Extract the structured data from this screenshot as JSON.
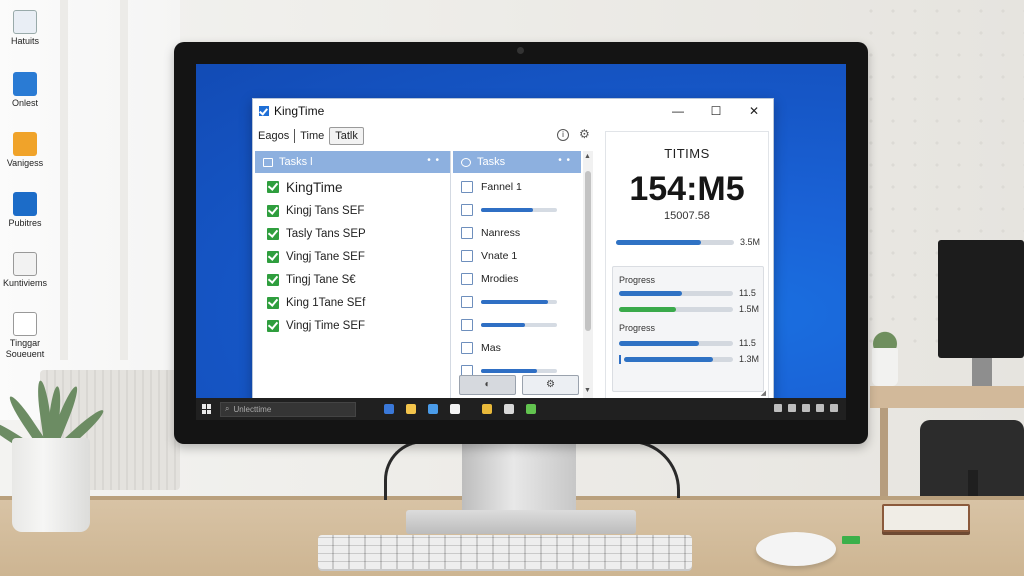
{
  "desktop_icons": [
    {
      "label": "Hatuits",
      "color": "#e9eef5"
    },
    {
      "label": "Onlest",
      "color": "#2a7bd4"
    },
    {
      "label": "Vanigess",
      "color": "#f0a32a"
    },
    {
      "label": "Pubitres",
      "color": "#1c6cc8"
    },
    {
      "label": "Kuntiviems",
      "color": "#f2f2f2"
    },
    {
      "label": "Tinggar Soueuent",
      "color": "#ffffff"
    }
  ],
  "app": {
    "title": "KingTime",
    "window_controls": {
      "minimize": "—",
      "maximize": "☐",
      "close": "✕"
    },
    "menu": [
      "Eagos",
      "Time",
      "Tatlk"
    ],
    "menu_active_index": 2,
    "info_icon_glyph": "i",
    "settings_icon_glyph": "⚙",
    "tasks_panel": {
      "header": "Tasks l",
      "header_dots": "• •",
      "items": [
        {
          "label": "KingTime",
          "checked": true
        },
        {
          "label": "Kingj Tans SEF",
          "checked": true
        },
        {
          "label": "Tasly Tans SEP",
          "checked": true
        },
        {
          "label": "Vingj Tane SEF",
          "checked": true
        },
        {
          "label": "Tingj Tane S€",
          "checked": true
        },
        {
          "label": "King 1Tane SEf",
          "checked": true
        },
        {
          "label": "Vingj Time SEF",
          "checked": true
        }
      ]
    },
    "mid_panel": {
      "header": "Tasks",
      "header_dots": "• •",
      "rows": [
        {
          "type": "label",
          "label": "Fannel 1"
        },
        {
          "type": "bar",
          "value": 0.68
        },
        {
          "type": "label",
          "label": "Nanress"
        },
        {
          "type": "label",
          "label": "Vnate 1"
        },
        {
          "type": "label",
          "label": "Mrodies"
        },
        {
          "type": "bar",
          "value": 0.88
        },
        {
          "type": "bar",
          "value": 0.58
        },
        {
          "type": "label",
          "label": "Mas"
        },
        {
          "type": "bar",
          "value": 0.74
        }
      ],
      "buttons": [
        "◐",
        "⚙"
      ]
    },
    "summary": {
      "title": "TITIMS",
      "big_value": "154:M5",
      "sub_value": "15007.58",
      "bar": {
        "value": 0.72,
        "label": "3.5M",
        "color": "#2f72c4"
      },
      "group1_label": "Progress",
      "group1_rows": [
        {
          "value": 0.55,
          "label": "11.5",
          "color": "#2f72c4"
        },
        {
          "value": 0.5,
          "label": "1.5M",
          "color": "#3aaa4b"
        }
      ],
      "group2_label": "Progress",
      "group2_rows": [
        {
          "value": 0.7,
          "label": "11.5",
          "color": "#2f72c4"
        },
        {
          "value": 0.82,
          "label": "1.3M",
          "color": "#2f72c4",
          "knob": true
        }
      ]
    }
  },
  "taskbar": {
    "search_placeholder": "Unlecttime",
    "app_icon_colors": [
      "#3a78d8",
      "#f3c44b",
      "#4a9be8",
      "#f2f2f2",
      "#e9b93a",
      "#d8d8d8",
      "#62c34f"
    ]
  },
  "colors": {
    "screen_blue": "#1657c7",
    "panel_header": "#8db0df",
    "check_green": "#2f9e3e"
  }
}
